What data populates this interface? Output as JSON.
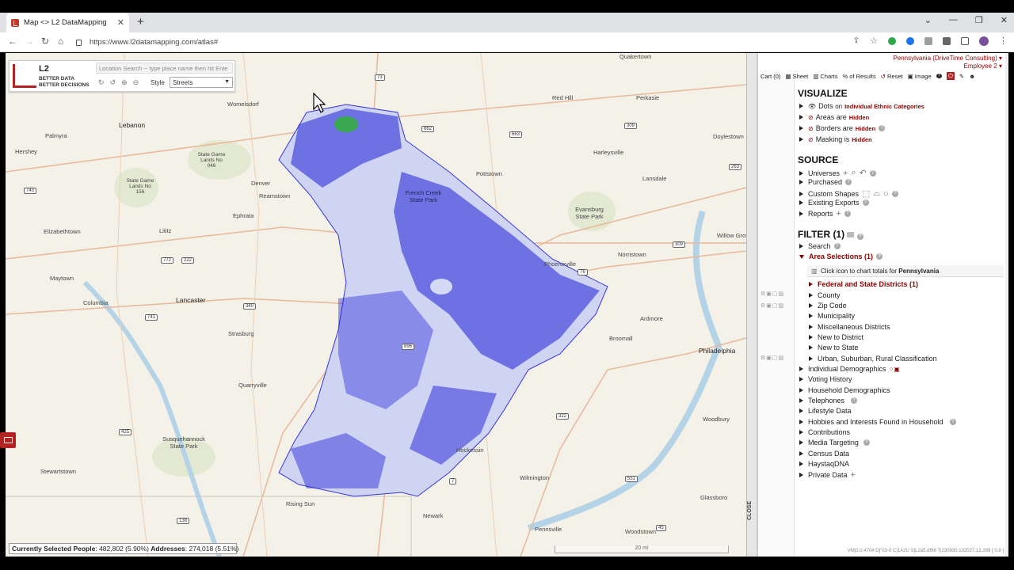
{
  "browser": {
    "tab_title": "Map <> L2 DataMapping",
    "url": "https://www.l2datamapping.com/atlas#"
  },
  "map": {
    "logo_l2": "L2",
    "logo_tag1": "BETTER DATA",
    "logo_tag2": "BETTER DECISIONS",
    "location_search_placeholder": "Location Search -- type place name then hit Ente",
    "style_label": "Style",
    "style_value": "Streets",
    "towns": [
      {
        "name": "Womelsdorf"
      },
      {
        "name": "Lebanon"
      },
      {
        "name": "Palmyra"
      },
      {
        "name": "Hershey"
      },
      {
        "name": "State Game Lands No 046"
      },
      {
        "name": "State Game Lands No 156"
      },
      {
        "name": "Denver"
      },
      {
        "name": "Reamstown"
      },
      {
        "name": "Ephrata"
      },
      {
        "name": "Elizabethtown"
      },
      {
        "name": "Lititz"
      },
      {
        "name": "Maytown"
      },
      {
        "name": "Columbia"
      },
      {
        "name": "Lancaster"
      },
      {
        "name": "Strasburg"
      },
      {
        "name": "Quarryville"
      },
      {
        "name": "Susquehannock State Park"
      },
      {
        "name": "Stewartstown"
      },
      {
        "name": "Rising Sun"
      },
      {
        "name": "Newark"
      },
      {
        "name": "Hockessin"
      },
      {
        "name": "Wilmington"
      },
      {
        "name": "Pennsville"
      },
      {
        "name": "Woodstown"
      },
      {
        "name": "Glassboro"
      },
      {
        "name": "Woodbury"
      },
      {
        "name": "Philadelphia"
      },
      {
        "name": "Broomall"
      },
      {
        "name": "Ardmore"
      },
      {
        "name": "Norristown"
      },
      {
        "name": "Willow Grove"
      },
      {
        "name": "Phoenixville"
      },
      {
        "name": "Evansburg State Park"
      },
      {
        "name": "Lansdale"
      },
      {
        "name": "Doylestown"
      },
      {
        "name": "Harleysville"
      },
      {
        "name": "Pottstown"
      },
      {
        "name": "Perkasie"
      },
      {
        "name": "Red Hill"
      },
      {
        "name": "Quakertown"
      },
      {
        "name": "French Creek State Park"
      }
    ],
    "shields": [
      "73",
      "662",
      "663",
      "309",
      "263",
      "743",
      "222",
      "772",
      "340",
      "741",
      "896",
      "425",
      "138",
      "7",
      "322",
      "551",
      "45",
      "309",
      "76"
    ],
    "status_label": "Currently Selected People",
    "status_people": ": 482,802 (5.90%)",
    "status_addr_label": "Addresses",
    "status_addresses": ": 274,018 (5.51%)",
    "scale_label": "20 mi",
    "close_label": "CLOSE"
  },
  "panel": {
    "account_line1": "Pennsylvania (DriveTime Consulting)",
    "account_line2": "Employee 2",
    "toolbar": {
      "cart": "Cart (0)",
      "sheet": "Sheet",
      "charts": "Charts",
      "pct": "% of Results",
      "reset": "Reset",
      "image": "Image"
    },
    "visualize_title": "VISUALIZE",
    "visualize": {
      "dots_label": "Dots",
      "dots_on": "on",
      "dots_value": "Individual Ethnic Categories",
      "areas_label": "Areas",
      "areas_are": "are",
      "areas_value": "Hidden",
      "borders_label": "Borders",
      "borders_are": "are",
      "borders_value": "Hidden",
      "masking_label": "Masking",
      "masking_is": "is",
      "masking_value": "Hidden"
    },
    "source_title": "SOURCE",
    "source_items": [
      "Universes",
      "Purchased",
      "Custom Shapes",
      "Existing Exports",
      "Reports"
    ],
    "filter_title": "FILTER (1)",
    "filter_search": "Search",
    "filter_area": "Area Selections (1)",
    "chart_hint_prefix": "Click icon to chart totals for",
    "chart_hint_state": "Pennsylvania",
    "area_sub": [
      "Federal and State Districts (1)",
      "County",
      "Zip Code",
      "Municipality",
      "Miscellaneous Districts",
      "New to District",
      "New to State",
      "Urban, Suburban, Rural Classification"
    ],
    "filter_items": [
      "Individual Demographics",
      "Voting History",
      "Household Demographics",
      "Telephones",
      "Lifestyle Data",
      "Hobbies and Interests Found in Household",
      "Contributions",
      "Media Targeting",
      "Census Data",
      "HaystaqDNA",
      "Private Data"
    ],
    "version": "VM|2.0.4704 D|\"03-0 C|1A2U S|L2a5.df96 T|230830.102027.12.289 [ 0.9 ]"
  }
}
